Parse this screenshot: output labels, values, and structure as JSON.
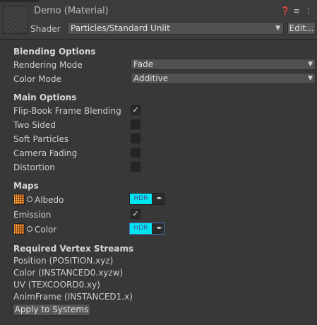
{
  "header": {
    "title": "Demo (Material)",
    "icons": [
      "help-icon",
      "settings-sliders-icon",
      "more-menu-icon"
    ],
    "shader_label": "Shader",
    "shader_value": "Particles/Standard Unlit",
    "edit_label": "Edit..."
  },
  "blending": {
    "title": "Blending Options",
    "rendering_mode_label": "Rendering Mode",
    "rendering_mode_value": "Fade",
    "color_mode_label": "Color Mode",
    "color_mode_value": "Additive"
  },
  "main_options": {
    "title": "Main Options",
    "items": [
      {
        "label": "Flip-Book Frame Blending",
        "checked": true
      },
      {
        "label": "Two Sided",
        "checked": false
      },
      {
        "label": "Soft Particles",
        "checked": false
      },
      {
        "label": "Camera Fading",
        "checked": false
      },
      {
        "label": "Distortion",
        "checked": false
      }
    ]
  },
  "maps": {
    "title": "Maps",
    "albedo_label": "Albedo",
    "albedo_badge": "HDR",
    "emission_label": "Emission",
    "emission_checked": true,
    "color_label": "Color",
    "color_badge": "HDR",
    "swatch_color": "#00e5ee"
  },
  "vertex_streams": {
    "title": "Required Vertex Streams",
    "items": [
      "Position (POSITION.xyz)",
      "Color (INSTANCED0.xyzw)",
      "UV (TEXCOORD0.xy)",
      "AnimFrame (INSTANCED1.x)"
    ],
    "apply_label": "Apply to Systems"
  }
}
